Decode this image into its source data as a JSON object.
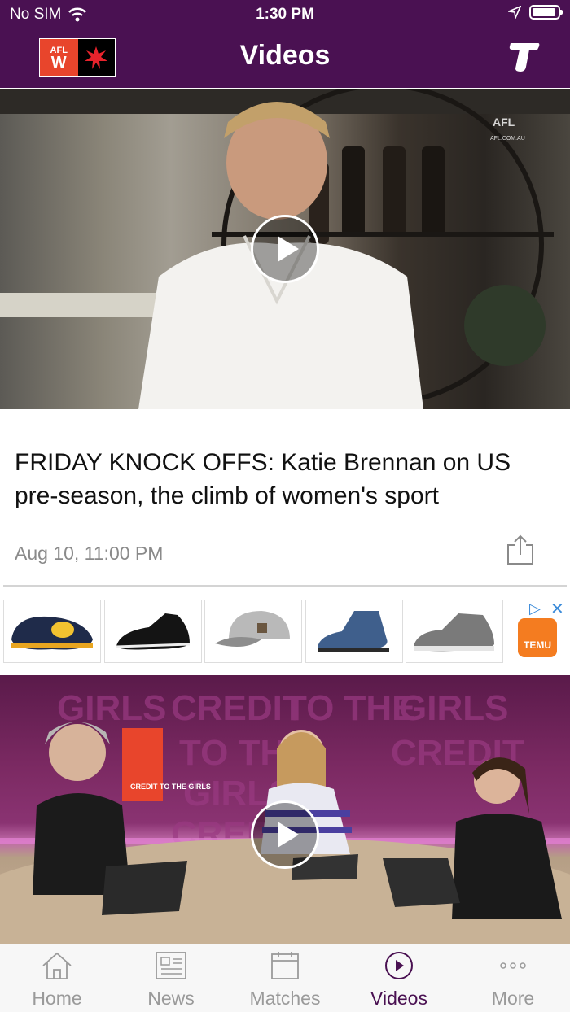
{
  "status_bar": {
    "carrier": "No SIM",
    "time": "1:30 PM"
  },
  "header": {
    "title": "Videos",
    "logo_text": "AFL",
    "logo_letter": "W"
  },
  "videos": [
    {
      "title": "FRIDAY KNOCK OFFS: Katie Brennan on US pre-season, the climb of women's sport",
      "date": "Aug 10, 11:00 PM",
      "watermark": "AFL",
      "watermark_sub": "AFL.COM.AU"
    },
    {
      "backdrop_words": [
        "GIRLS",
        "CREDIT",
        "TO THE",
        "GIRLS",
        "CREDIT",
        "TO THE",
        "GIRLS",
        "CREDIT"
      ],
      "sign_text": "CREDIT TO THE GIRLS"
    }
  ],
  "ad": {
    "brand": "TEMU",
    "items": [
      "clog",
      "dress-shoe",
      "cap",
      "boot",
      "sneaker"
    ]
  },
  "tabs": [
    {
      "label": "Home",
      "icon": "home-icon",
      "active": false
    },
    {
      "label": "News",
      "icon": "news-icon",
      "active": false
    },
    {
      "label": "Matches",
      "icon": "calendar-icon",
      "active": false
    },
    {
      "label": "Videos",
      "icon": "play-circle-icon",
      "active": true
    },
    {
      "label": "More",
      "icon": "more-dots-icon",
      "active": false
    }
  ],
  "colors": {
    "brand": "#4a1152",
    "inactive": "#9a9a9a",
    "afl_red": "#e8452c"
  }
}
